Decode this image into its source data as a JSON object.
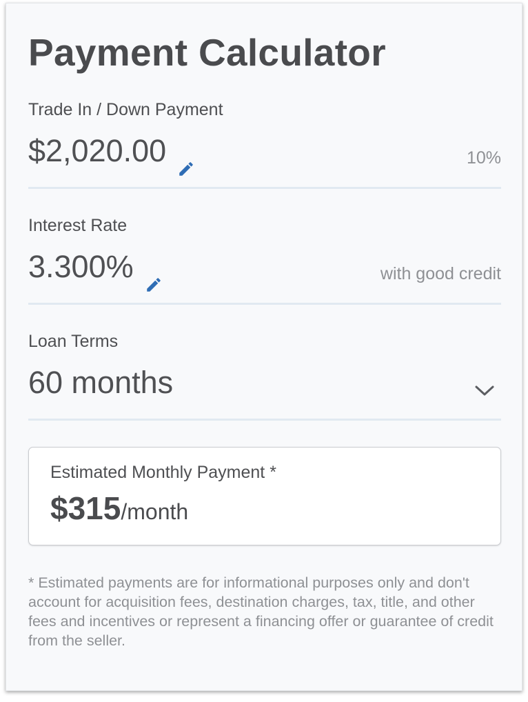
{
  "title": "Payment Calculator",
  "trade_in": {
    "label": "Trade In / Down Payment",
    "value": "$2,020.00",
    "note": "10%"
  },
  "interest": {
    "label": "Interest Rate",
    "value": "3.300%",
    "note": "with good credit"
  },
  "loan_terms": {
    "label": "Loan Terms",
    "value": "60 months"
  },
  "estimate": {
    "label": "Estimated Monthly Payment *",
    "amount": "$315",
    "unit": "/month"
  },
  "disclaimer": "* Estimated payments are for informational purposes only and don't account for acquisition fees, destination charges, tax, title, and other fees and incentives or represent a financing offer or guarantee of credit from the seller.",
  "icons": {
    "edit": "pencil-icon",
    "dropdown": "chevron-down-icon"
  },
  "colors": {
    "accent": "#2f6db5",
    "text": "#4a4b4e",
    "muted": "#8e9094",
    "divider": "#e1e9f1",
    "card_background": "#f8f9fb"
  }
}
